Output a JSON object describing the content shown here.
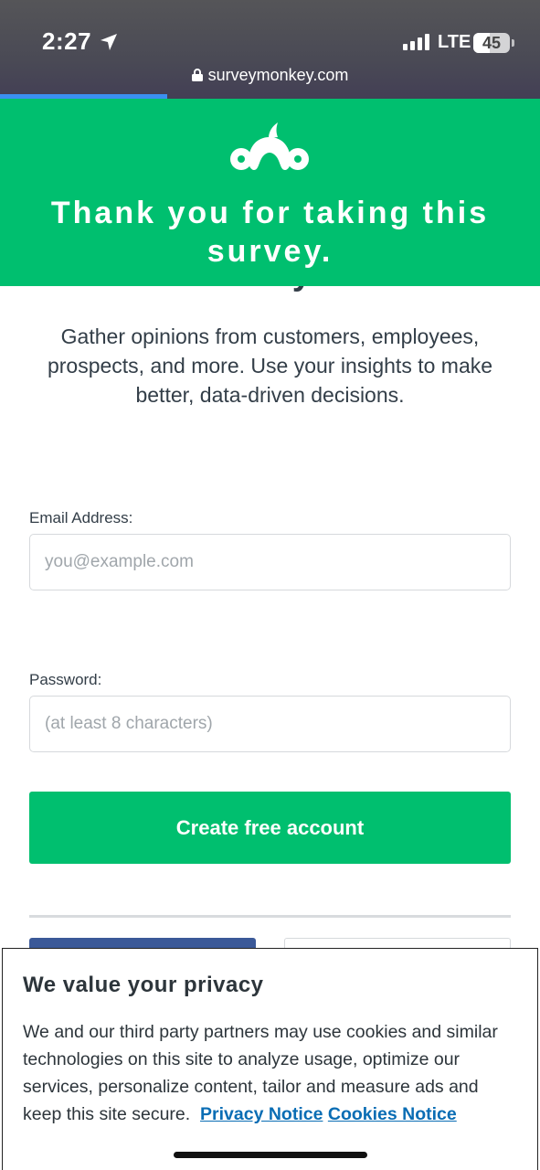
{
  "status_bar": {
    "time": "2:27",
    "network": "LTE",
    "battery": "45",
    "battery_level": 0.45
  },
  "browser": {
    "url": "surveymonkey.com",
    "load_progress": 0.31
  },
  "banner": {
    "logo_icon": "surveymonkey-logo-icon",
    "title": "Thank you for taking this survey.",
    "background": "#00bf6f"
  },
  "main": {
    "peek_heading": "surveys.",
    "intro": "Gather opinions from customers, employees, prospects, and more. Use your insights to make better, data-driven decisions.",
    "email": {
      "label": "Email Address:",
      "placeholder": "you@example.com",
      "value": ""
    },
    "password": {
      "label": "Password:",
      "placeholder": "(at least 8 characters)",
      "value": ""
    },
    "create_button": "Create free account"
  },
  "privacy": {
    "title": "We value your privacy",
    "body": "We and our third party partners may use cookies and similar technologies on this site to analyze usage, optimize our services, personalize content, tailor and measure ads and keep this site secure.",
    "privacy_link": "Privacy Notice",
    "cookies_link": "Cookies Notice"
  },
  "colors": {
    "brand_green": "#00bf6f",
    "link_blue": "#0a6db4",
    "progress_blue": "#3b8ff0"
  }
}
